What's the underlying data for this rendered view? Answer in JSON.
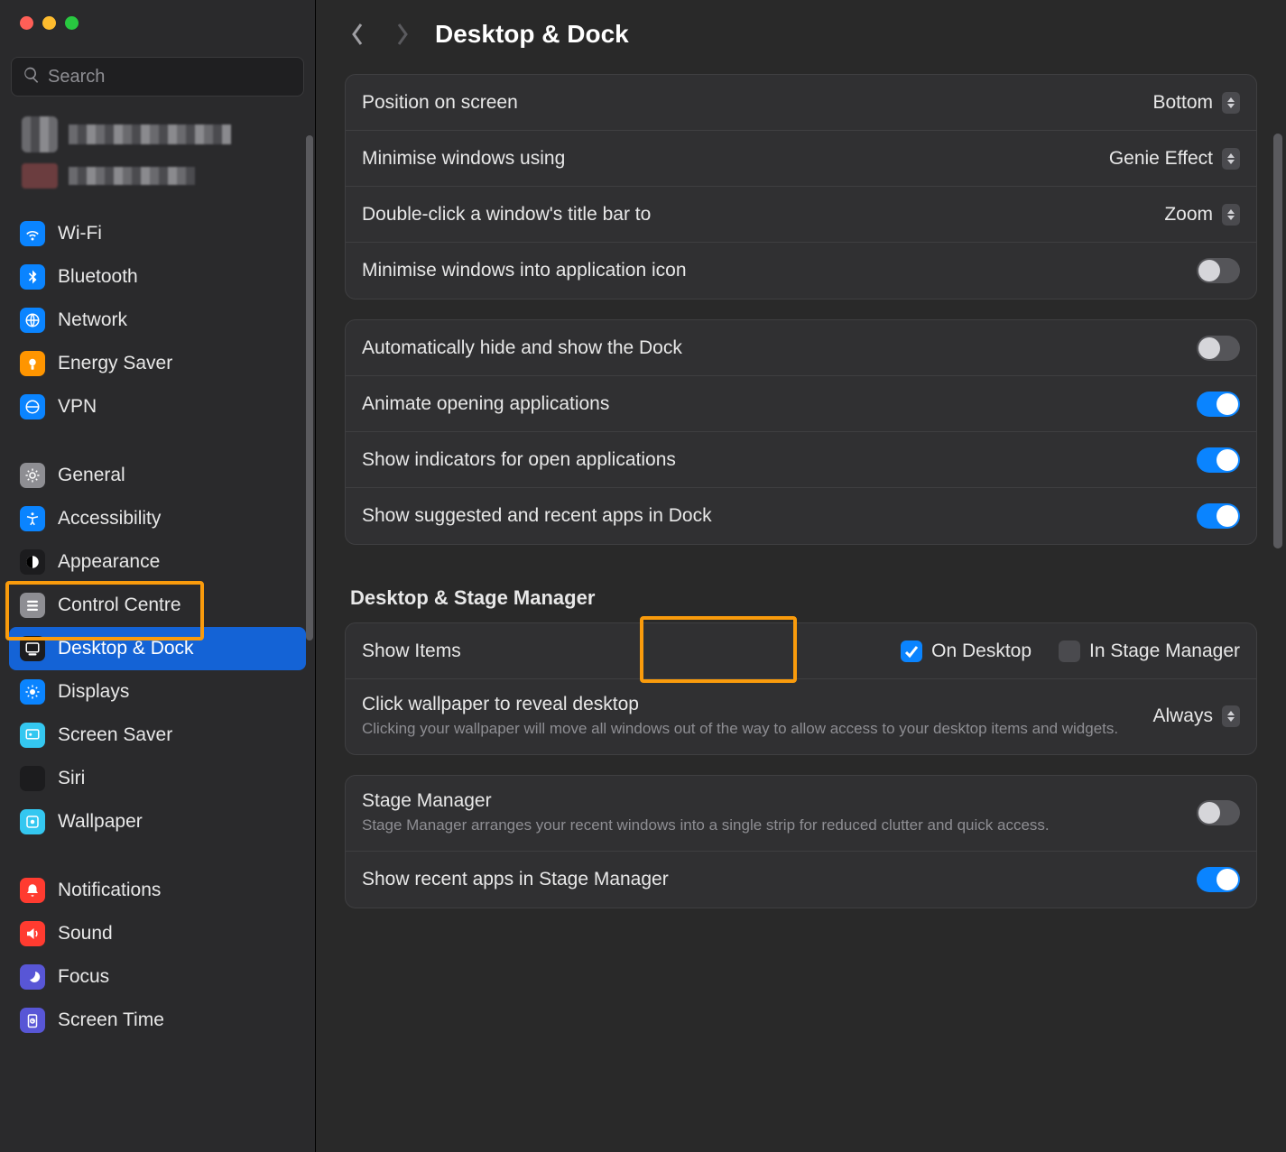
{
  "window": {
    "search_placeholder": "Search",
    "page_title": "Desktop & Dock"
  },
  "sidebar": [
    {
      "id": "wifi",
      "label": "Wi-Fi",
      "color": "#0a84ff"
    },
    {
      "id": "bluetooth",
      "label": "Bluetooth",
      "color": "#0a84ff"
    },
    {
      "id": "network",
      "label": "Network",
      "color": "#0a84ff"
    },
    {
      "id": "energy",
      "label": "Energy Saver",
      "color": "#ff9500"
    },
    {
      "id": "vpn",
      "label": "VPN",
      "color": "#0a84ff"
    },
    {
      "id": "gap"
    },
    {
      "id": "general",
      "label": "General",
      "color": "#8e8e93"
    },
    {
      "id": "accessibility",
      "label": "Accessibility",
      "color": "#0a84ff"
    },
    {
      "id": "appearance",
      "label": "Appearance",
      "color": "#1c1c1e"
    },
    {
      "id": "control",
      "label": "Control Centre",
      "color": "#8e8e93"
    },
    {
      "id": "desktop",
      "label": "Desktop & Dock",
      "color": "#1c1c1e",
      "selected": true
    },
    {
      "id": "displays",
      "label": "Displays",
      "color": "#0a84ff"
    },
    {
      "id": "screensaver",
      "label": "Screen Saver",
      "color": "#34c7f0"
    },
    {
      "id": "siri",
      "label": "Siri",
      "color": "#1c1c1e"
    },
    {
      "id": "wallpaper",
      "label": "Wallpaper",
      "color": "#34c7f0"
    },
    {
      "id": "gap"
    },
    {
      "id": "notifications",
      "label": "Notifications",
      "color": "#ff3b30"
    },
    {
      "id": "sound",
      "label": "Sound",
      "color": "#ff3b30"
    },
    {
      "id": "focus",
      "label": "Focus",
      "color": "#5856d6"
    },
    {
      "id": "screentime",
      "label": "Screen Time",
      "color": "#5856d6"
    }
  ],
  "settings": {
    "position": {
      "label": "Position on screen",
      "value": "Bottom"
    },
    "minimise_using": {
      "label": "Minimise windows using",
      "value": "Genie Effect"
    },
    "doubleclick": {
      "label": "Double-click a window's title bar to",
      "value": "Zoom"
    },
    "min_into_app": {
      "label": "Minimise windows into application icon",
      "on": false
    },
    "autohide": {
      "label": "Automatically hide and show the Dock",
      "on": false
    },
    "animate": {
      "label": "Animate opening applications",
      "on": true
    },
    "indicators": {
      "label": "Show indicators for open applications",
      "on": true
    },
    "recent_dock": {
      "label": "Show suggested and recent apps in Dock",
      "on": true
    },
    "stage_section_title": "Desktop & Stage Manager",
    "show_items": {
      "label": "Show Items",
      "on_desktop": "On Desktop",
      "on_desktop_checked": true,
      "in_sm": "In Stage Manager",
      "in_sm_checked": false
    },
    "click_wallpaper": {
      "label": "Click wallpaper to reveal desktop",
      "sub": "Clicking your wallpaper will move all windows out of the way to allow access to your desktop items and widgets.",
      "value": "Always"
    },
    "stage_manager": {
      "label": "Stage Manager",
      "sub": "Stage Manager arranges your recent windows into a single strip for reduced clutter and quick access.",
      "on": false
    },
    "recent_sm": {
      "label": "Show recent apps in Stage Manager",
      "on": true
    }
  }
}
